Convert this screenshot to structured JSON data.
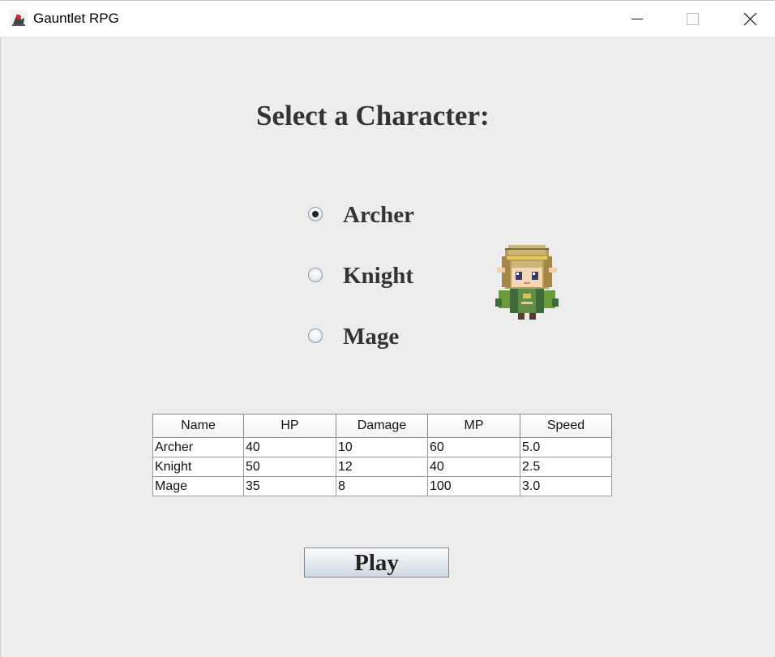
{
  "window": {
    "title": "Gauntlet RPG",
    "app_icon": "java-duke-icon",
    "controls": [
      "minimize-icon",
      "maximize-icon",
      "close-icon"
    ]
  },
  "main": {
    "heading": "Select a Character:",
    "options": [
      {
        "label": "Archer",
        "selected": true
      },
      {
        "label": "Knight",
        "selected": false
      },
      {
        "label": "Mage",
        "selected": false
      }
    ],
    "preview_sprite": "archer-character-sprite"
  },
  "table": {
    "columns": [
      "Name",
      "HP",
      "Damage",
      "MP",
      "Speed"
    ],
    "rows": [
      [
        "Archer",
        "40",
        "10",
        "60",
        "5.0"
      ],
      [
        "Knight",
        "50",
        "12",
        "40",
        "2.5"
      ],
      [
        "Mage",
        "35",
        "8",
        "100",
        "3.0"
      ]
    ]
  },
  "play_button": {
    "label": "Play"
  },
  "colors": {
    "background": "#ededed",
    "titlebar": "#ffffff",
    "text": "#333333"
  }
}
